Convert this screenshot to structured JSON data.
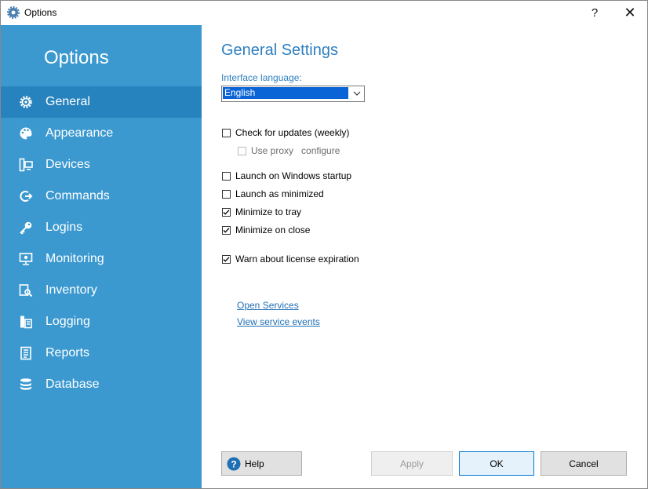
{
  "window": {
    "title": "Options",
    "help_glyph": "?",
    "close_glyph": "✕",
    "icon": "gear-icon"
  },
  "colors": {
    "sidebar_bg": "#3b99d0",
    "sidebar_active": "#2783bd",
    "heading": "#2f7fbf",
    "link": "#1f6fb5",
    "ok_border": "#0078d7"
  },
  "sidebar": {
    "title": "Options",
    "items": [
      {
        "label": "General",
        "icon": "gear-icon",
        "active": true
      },
      {
        "label": "Appearance",
        "icon": "palette-icon",
        "active": false
      },
      {
        "label": "Devices",
        "icon": "devices-icon",
        "active": false
      },
      {
        "label": "Commands",
        "icon": "command-icon",
        "active": false
      },
      {
        "label": "Logins",
        "icon": "key-icon",
        "active": false
      },
      {
        "label": "Monitoring",
        "icon": "monitor-icon",
        "active": false
      },
      {
        "label": "Inventory",
        "icon": "inventory-icon",
        "active": false
      },
      {
        "label": "Logging",
        "icon": "logging-icon",
        "active": false
      },
      {
        "label": "Reports",
        "icon": "report-icon",
        "active": false
      },
      {
        "label": "Database",
        "icon": "database-icon",
        "active": false
      }
    ]
  },
  "general": {
    "heading": "General Settings",
    "language_label": "Interface language:",
    "language_value": "English",
    "check_updates": {
      "label": "Check for updates (weekly)",
      "checked": false
    },
    "use_proxy": {
      "label": "Use proxy",
      "checked": false,
      "disabled": true
    },
    "configure_label": "configure",
    "launch_startup": {
      "label": "Launch on Windows startup",
      "checked": false
    },
    "launch_minimized": {
      "label": "Launch as minimized",
      "checked": false
    },
    "minimize_tray": {
      "label": "Minimize to tray",
      "checked": true
    },
    "minimize_close": {
      "label": "Minimize on close",
      "checked": true
    },
    "warn_license": {
      "label": "Warn about license expiration",
      "checked": true
    },
    "open_services": "Open Services",
    "view_events": "View service events"
  },
  "buttons": {
    "help": "Help",
    "apply": "Apply",
    "ok": "OK",
    "cancel": "Cancel"
  }
}
